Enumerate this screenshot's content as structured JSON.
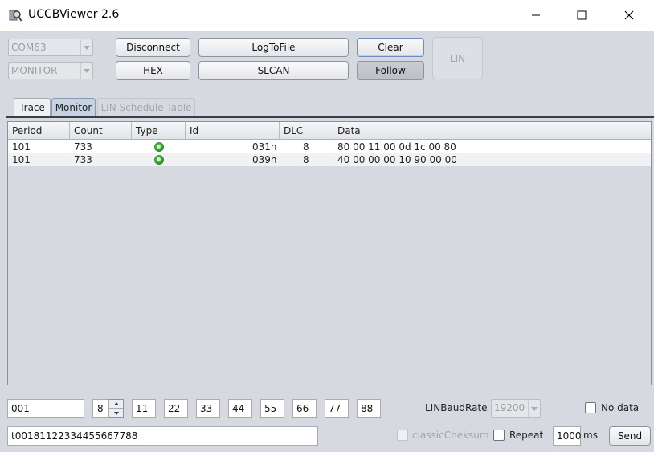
{
  "window": {
    "title": "UCCBViewer 2.6",
    "icon": "magnifier-app-icon"
  },
  "controls": {
    "port_value": "COM63",
    "mode_value": "MONITOR",
    "disconnect_label": "Disconnect",
    "logtofile_label": "LogToFile",
    "clear_label": "Clear",
    "hex_label": "HEX",
    "slcan_label": "SLCAN",
    "follow_label": "Follow",
    "lin_label": "LIN"
  },
  "tabs": [
    {
      "label": "Trace",
      "state": "normal"
    },
    {
      "label": "Monitor",
      "state": "selected"
    },
    {
      "label": "LIN Schedule Table",
      "state": "disabled"
    }
  ],
  "table": {
    "headers": [
      "Period",
      "Count",
      "Type",
      "Id",
      "DLC",
      "Data"
    ],
    "rows": [
      {
        "period": "101",
        "count": "733",
        "type": "standard-frame-icon",
        "id": "031h",
        "dlc": "8",
        "data": "80 00 11 00 0d 1c 00 80"
      },
      {
        "period": "101",
        "count": "733",
        "type": "standard-frame-icon",
        "id": "039h",
        "dlc": "8",
        "data": "40 00 00 00 10 90 00 00"
      }
    ]
  },
  "send": {
    "id_value": "001",
    "dlc_value": "8",
    "bytes": [
      "11",
      "22",
      "33",
      "44",
      "55",
      "66",
      "77",
      "88"
    ],
    "linbaud_label": "LINBaudRate",
    "linbaud_value": "19200",
    "nodata_label": "No data",
    "raw_value": "t00181122334455667788",
    "classic_label": "classicCheksum",
    "repeat_label": "Repeat",
    "interval_value": "1000",
    "ms_label": "ms",
    "send_label": "Send"
  },
  "colors": {
    "background": "#d6d9df",
    "selected_tab": "#c7d3e3",
    "frame_icon_green": "#4bb04a"
  }
}
